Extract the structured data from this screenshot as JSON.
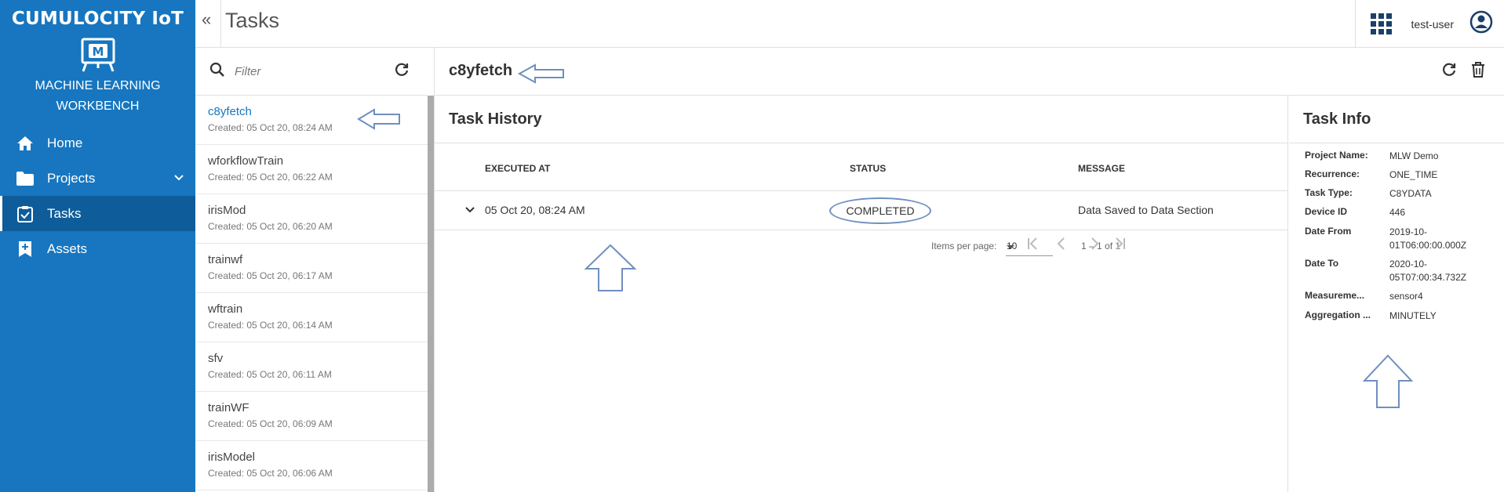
{
  "brand": "CUMULOCITY IoT",
  "app_name_line1": "MACHINE LEARNING",
  "app_name_line2": "WORKBENCH",
  "nav": {
    "home": "Home",
    "projects": "Projects",
    "tasks": "Tasks",
    "assets": "Assets"
  },
  "header": {
    "collapse": "«",
    "title": "Tasks",
    "user": "test-user"
  },
  "filter": {
    "placeholder": "Filter"
  },
  "tasks": [
    {
      "name": "c8yfetch",
      "created": "Created: 05 Oct 20, 08:24 AM"
    },
    {
      "name": "wforkflowTrain",
      "created": "Created: 05 Oct 20, 06:22 AM"
    },
    {
      "name": "irisMod",
      "created": "Created: 05 Oct 20, 06:20 AM"
    },
    {
      "name": "trainwf",
      "created": "Created: 05 Oct 20, 06:17 AM"
    },
    {
      "name": "wftrain",
      "created": "Created: 05 Oct 20, 06:14 AM"
    },
    {
      "name": "sfv",
      "created": "Created: 05 Oct 20, 06:11 AM"
    },
    {
      "name": "trainWF",
      "created": "Created: 05 Oct 20, 06:09 AM"
    },
    {
      "name": "irisModel",
      "created": "Created: 05 Oct 20, 06:06 AM"
    }
  ],
  "detail": {
    "title": "c8yfetch"
  },
  "history": {
    "title": "Task History",
    "columns": {
      "executed": "EXECUTED AT",
      "status": "STATUS",
      "message": "MESSAGE"
    },
    "rows": [
      {
        "executed": "05 Oct 20, 08:24 AM",
        "status": "COMPLETED",
        "message": "Data Saved to Data Section"
      }
    ],
    "paginator": {
      "label": "Items per page:",
      "page_size": "10",
      "range": "1 – 1 of 1"
    }
  },
  "info": {
    "title": "Task Info",
    "rows": [
      {
        "key": "Project Name:",
        "value": "MLW Demo"
      },
      {
        "key": "Recurrence:",
        "value": "ONE_TIME"
      },
      {
        "key": "Task Type:",
        "value": "C8YDATA"
      },
      {
        "key": "Device ID",
        "value": "446"
      },
      {
        "key": "Date From",
        "value": "2019-10-01T06:00:00.000Z"
      },
      {
        "key": "Date To",
        "value": "2020-10-05T07:00:34.732Z"
      },
      {
        "key": "Measureme...",
        "value": "sensor4"
      },
      {
        "key": "Aggregation ...",
        "value": "MINUTELY"
      }
    ]
  },
  "colors": {
    "brand_blue": "#1776bf",
    "active_nav": "#0e5d9a",
    "annotation": "#6f8fc0"
  }
}
